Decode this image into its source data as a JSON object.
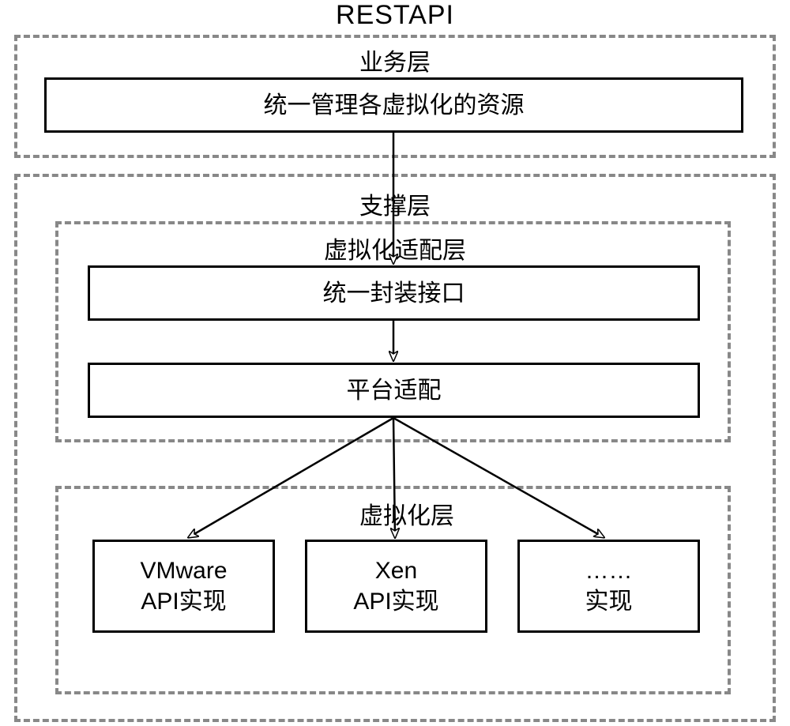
{
  "title": "RESTAPI",
  "business_layer": {
    "label": "业务层",
    "box": "统一管理各虚拟化的资源"
  },
  "support_layer": {
    "label": "支撑层",
    "adapter_layer": {
      "label": "虚拟化适配层",
      "unified_interface": "统一封装接口",
      "platform_adapter": "平台适配"
    },
    "virtualization_layer": {
      "label": "虚拟化层",
      "items": [
        {
          "line1": "VMware",
          "line2": "API实现"
        },
        {
          "line1": "Xen",
          "line2": "API实现"
        },
        {
          "line1": "……",
          "line2": "实现"
        }
      ]
    }
  }
}
